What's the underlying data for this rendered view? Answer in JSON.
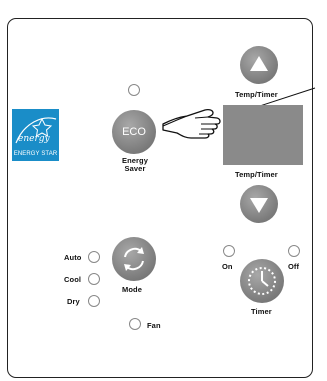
{
  "panel": {
    "energy_star": {
      "caption": "ENERGY STAR",
      "script": "energy"
    },
    "eco": {
      "button_label": "ECO",
      "caption_line1": "Energy",
      "caption_line2": "Saver"
    },
    "temp_timer_up_label": "Temp/Timer",
    "temp_timer_down_label": "Temp/Timer",
    "modes": {
      "auto": "Auto",
      "cool": "Cool",
      "dry": "Dry",
      "fan": "Fan",
      "mode_button_label": "Mode"
    },
    "timer": {
      "on": "On",
      "off": "Off",
      "timer_label": "Timer"
    }
  },
  "colors": {
    "energy_star_blue": "#1a8dc8",
    "button_gray": "#8a8a8a",
    "outline": "#222222"
  }
}
